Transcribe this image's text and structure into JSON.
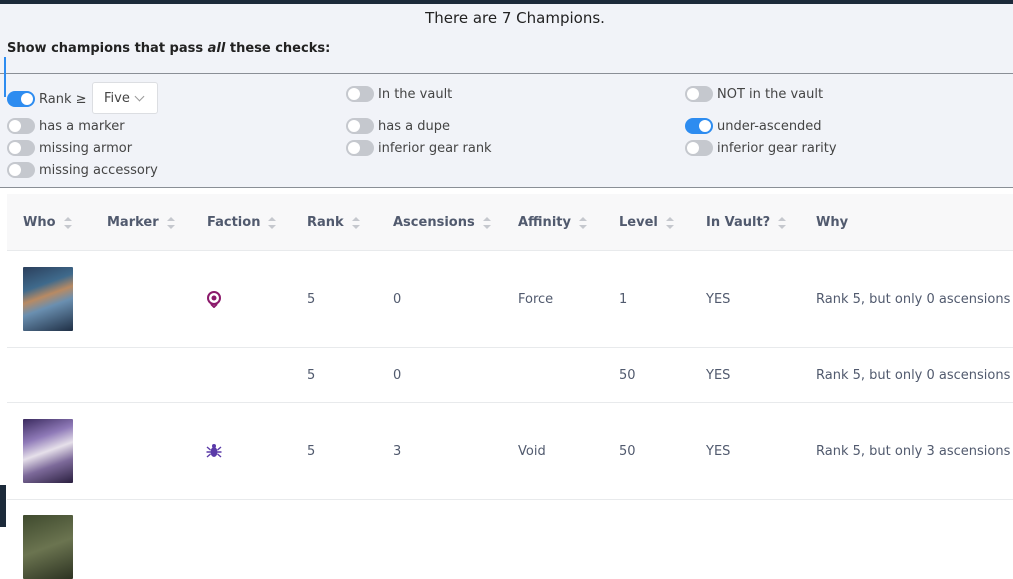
{
  "header": {
    "title": "There are 7 Champions.",
    "checks_prefix": "Show champions that pass ",
    "checks_emphasis": "all",
    "checks_suffix": " these checks:"
  },
  "filters": {
    "rank": {
      "label": "Rank ≥",
      "on": true,
      "select_value": "Five"
    },
    "in_vault": {
      "label": "In the vault",
      "on": false
    },
    "not_in_vault": {
      "label": "NOT in the vault",
      "on": false
    },
    "has_marker": {
      "label": "has a marker",
      "on": false
    },
    "has_dupe": {
      "label": "has a dupe",
      "on": false
    },
    "under_ascended": {
      "label": "under-ascended",
      "on": true
    },
    "missing_armor": {
      "label": "missing armor",
      "on": false
    },
    "inferior_gear_rank": {
      "label": "inferior gear rank",
      "on": false
    },
    "inferior_gear_rarity": {
      "label": "inferior gear rarity",
      "on": false
    },
    "missing_accessory": {
      "label": "missing accessory",
      "on": false
    }
  },
  "table": {
    "columns": [
      "Who",
      "Marker",
      "Faction",
      "Rank",
      "Ascensions",
      "Affinity",
      "Level",
      "In Vault?",
      "Why"
    ],
    "rows": [
      {
        "portrait": "champion-portrait-blue-armored",
        "faction_icon": "faction-skull-sigil-icon",
        "rank": "5",
        "ascensions": "0",
        "affinity": "Force",
        "level": "1",
        "in_vault": "YES",
        "why": "Rank 5, but only 0 ascensions"
      },
      {
        "portrait": "",
        "faction_icon": "",
        "rank": "5",
        "ascensions": "0",
        "affinity": "",
        "level": "50",
        "in_vault": "YES",
        "why": "Rank 5, but only 0 ascensions"
      },
      {
        "portrait": "champion-portrait-pale-horned",
        "faction_icon": "faction-spider-icon",
        "rank": "5",
        "ascensions": "3",
        "affinity": "Void",
        "level": "50",
        "in_vault": "YES",
        "why": "Rank 5, but only 3 ascensions"
      },
      {
        "portrait": "champion-portrait-dark",
        "faction_icon": "",
        "rank": "",
        "ascensions": "",
        "affinity": "",
        "level": "",
        "in_vault": "",
        "why": ""
      }
    ]
  },
  "colors": {
    "accent": "#2d8cf0",
    "faction_skull": "#8b1a6b",
    "faction_spider": "#5a3aa8"
  }
}
